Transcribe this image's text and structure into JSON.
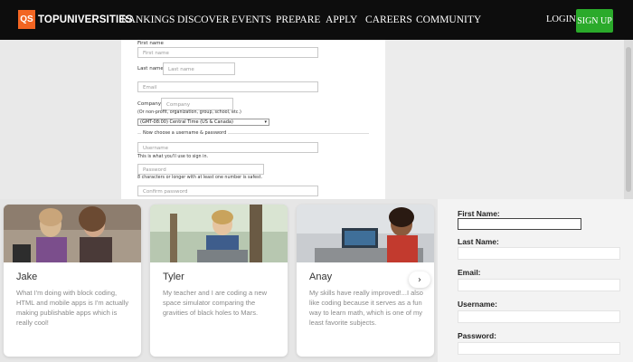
{
  "nav": {
    "logo_badge": "QS",
    "logo_text": "TOPUNIVERSITIES",
    "menu": [
      "RANKINGS",
      "DISCOVER",
      "EVENTS",
      "PREPARE",
      "APPLY",
      "CAREERS",
      "COMMUNITY"
    ],
    "login": "LOGIN",
    "signup": "SIGN UP",
    "colors": {
      "brand": "#f26522",
      "signup": "#2aaa2a"
    }
  },
  "form": {
    "first_name_label": "First name",
    "first_name_placeholder": "First name",
    "last_name_label": "Last name",
    "last_name_placeholder": "Last name",
    "email_placeholder": "Email",
    "company_label": "Company",
    "company_placeholder": "Company",
    "company_hint": "(Or non-profit, organization, group, school, etc.)",
    "timezone_value": "(GMT-08:00) Central Time (US & Canada)",
    "section_title": "Now choose a username & password",
    "username_placeholder": "Username",
    "username_hint": "This is what you'll use to sign in.",
    "password_placeholder": "Password",
    "password_hint": "8 characters or longer with at least one number is safest.",
    "confirm_placeholder": "Confirm password"
  },
  "testimonials": [
    {
      "name": "Jake",
      "text": "What I'm doing with block coding, HTML and mobile apps is I'm actually making publishable apps which is really cool!"
    },
    {
      "name": "Tyler",
      "text": "My teacher and I are coding a new space simulator comparing the gravities of black holes to Mars."
    },
    {
      "name": "Anay",
      "text": "My skills have really improved!...I also like coding because it serves as a fun way to learn math, which is one of my least favorite subjects."
    }
  ],
  "carousel": {
    "next_label": "›"
  },
  "signup_form": {
    "first_name": "First Name:",
    "last_name": "Last Name:",
    "email": "Email:",
    "username": "Username:",
    "password": "Password:"
  }
}
